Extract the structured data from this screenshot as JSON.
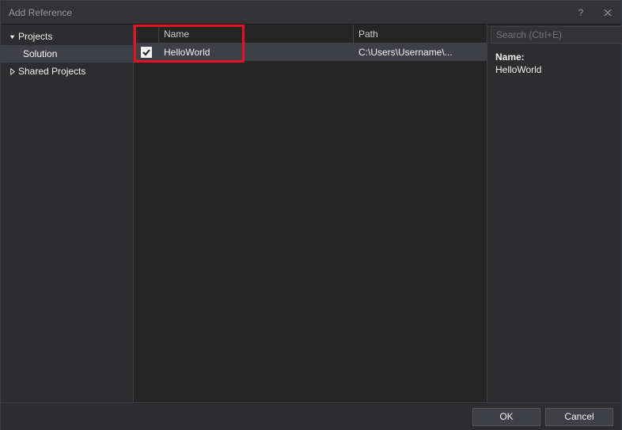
{
  "titlebar": {
    "title": "Add Reference",
    "help": "?",
    "close": "×"
  },
  "sidebar": {
    "projects_label": "Projects",
    "solution_label": "Solution",
    "shared_label": "Shared Projects"
  },
  "table": {
    "col_name": "Name",
    "col_path": "Path",
    "rows": [
      {
        "name": "HelloWorld",
        "path": "C:\\Users\\Username\\...",
        "checked": true
      }
    ]
  },
  "search": {
    "placeholder": "Search (Ctrl+E)"
  },
  "details": {
    "name_label": "Name:",
    "name_value": "HelloWorld"
  },
  "footer": {
    "ok": "OK",
    "cancel": "Cancel"
  }
}
